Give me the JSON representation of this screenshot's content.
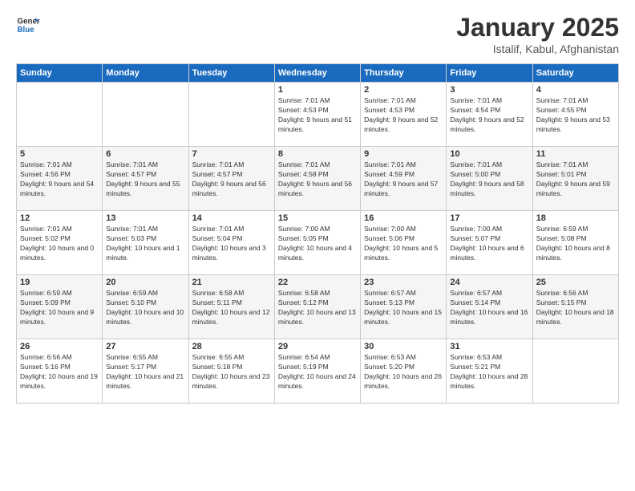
{
  "header": {
    "logo_general": "General",
    "logo_blue": "Blue",
    "title": "January 2025",
    "subtitle": "Istalif, Kabul, Afghanistan"
  },
  "weekdays": [
    "Sunday",
    "Monday",
    "Tuesday",
    "Wednesday",
    "Thursday",
    "Friday",
    "Saturday"
  ],
  "weeks": [
    [
      {
        "day": "",
        "content": ""
      },
      {
        "day": "",
        "content": ""
      },
      {
        "day": "",
        "content": ""
      },
      {
        "day": "1",
        "content": "Sunrise: 7:01 AM\nSunset: 4:53 PM\nDaylight: 9 hours and 51 minutes."
      },
      {
        "day": "2",
        "content": "Sunrise: 7:01 AM\nSunset: 4:53 PM\nDaylight: 9 hours and 52 minutes."
      },
      {
        "day": "3",
        "content": "Sunrise: 7:01 AM\nSunset: 4:54 PM\nDaylight: 9 hours and 52 minutes."
      },
      {
        "day": "4",
        "content": "Sunrise: 7:01 AM\nSunset: 4:55 PM\nDaylight: 9 hours and 53 minutes."
      }
    ],
    [
      {
        "day": "5",
        "content": "Sunrise: 7:01 AM\nSunset: 4:56 PM\nDaylight: 9 hours and 54 minutes."
      },
      {
        "day": "6",
        "content": "Sunrise: 7:01 AM\nSunset: 4:57 PM\nDaylight: 9 hours and 55 minutes."
      },
      {
        "day": "7",
        "content": "Sunrise: 7:01 AM\nSunset: 4:57 PM\nDaylight: 9 hours and 56 minutes."
      },
      {
        "day": "8",
        "content": "Sunrise: 7:01 AM\nSunset: 4:58 PM\nDaylight: 9 hours and 56 minutes."
      },
      {
        "day": "9",
        "content": "Sunrise: 7:01 AM\nSunset: 4:59 PM\nDaylight: 9 hours and 57 minutes."
      },
      {
        "day": "10",
        "content": "Sunrise: 7:01 AM\nSunset: 5:00 PM\nDaylight: 9 hours and 58 minutes."
      },
      {
        "day": "11",
        "content": "Sunrise: 7:01 AM\nSunset: 5:01 PM\nDaylight: 9 hours and 59 minutes."
      }
    ],
    [
      {
        "day": "12",
        "content": "Sunrise: 7:01 AM\nSunset: 5:02 PM\nDaylight: 10 hours and 0 minutes."
      },
      {
        "day": "13",
        "content": "Sunrise: 7:01 AM\nSunset: 5:03 PM\nDaylight: 10 hours and 1 minute."
      },
      {
        "day": "14",
        "content": "Sunrise: 7:01 AM\nSunset: 5:04 PM\nDaylight: 10 hours and 3 minutes."
      },
      {
        "day": "15",
        "content": "Sunrise: 7:00 AM\nSunset: 5:05 PM\nDaylight: 10 hours and 4 minutes."
      },
      {
        "day": "16",
        "content": "Sunrise: 7:00 AM\nSunset: 5:06 PM\nDaylight: 10 hours and 5 minutes."
      },
      {
        "day": "17",
        "content": "Sunrise: 7:00 AM\nSunset: 5:07 PM\nDaylight: 10 hours and 6 minutes."
      },
      {
        "day": "18",
        "content": "Sunrise: 6:59 AM\nSunset: 5:08 PM\nDaylight: 10 hours and 8 minutes."
      }
    ],
    [
      {
        "day": "19",
        "content": "Sunrise: 6:59 AM\nSunset: 5:09 PM\nDaylight: 10 hours and 9 minutes."
      },
      {
        "day": "20",
        "content": "Sunrise: 6:59 AM\nSunset: 5:10 PM\nDaylight: 10 hours and 10 minutes."
      },
      {
        "day": "21",
        "content": "Sunrise: 6:58 AM\nSunset: 5:11 PM\nDaylight: 10 hours and 12 minutes."
      },
      {
        "day": "22",
        "content": "Sunrise: 6:58 AM\nSunset: 5:12 PM\nDaylight: 10 hours and 13 minutes."
      },
      {
        "day": "23",
        "content": "Sunrise: 6:57 AM\nSunset: 5:13 PM\nDaylight: 10 hours and 15 minutes."
      },
      {
        "day": "24",
        "content": "Sunrise: 6:57 AM\nSunset: 5:14 PM\nDaylight: 10 hours and 16 minutes."
      },
      {
        "day": "25",
        "content": "Sunrise: 6:56 AM\nSunset: 5:15 PM\nDaylight: 10 hours and 18 minutes."
      }
    ],
    [
      {
        "day": "26",
        "content": "Sunrise: 6:56 AM\nSunset: 5:16 PM\nDaylight: 10 hours and 19 minutes."
      },
      {
        "day": "27",
        "content": "Sunrise: 6:55 AM\nSunset: 5:17 PM\nDaylight: 10 hours and 21 minutes."
      },
      {
        "day": "28",
        "content": "Sunrise: 6:55 AM\nSunset: 5:18 PM\nDaylight: 10 hours and 23 minutes."
      },
      {
        "day": "29",
        "content": "Sunrise: 6:54 AM\nSunset: 5:19 PM\nDaylight: 10 hours and 24 minutes."
      },
      {
        "day": "30",
        "content": "Sunrise: 6:53 AM\nSunset: 5:20 PM\nDaylight: 10 hours and 26 minutes."
      },
      {
        "day": "31",
        "content": "Sunrise: 6:53 AM\nSunset: 5:21 PM\nDaylight: 10 hours and 28 minutes."
      },
      {
        "day": "",
        "content": ""
      }
    ]
  ]
}
